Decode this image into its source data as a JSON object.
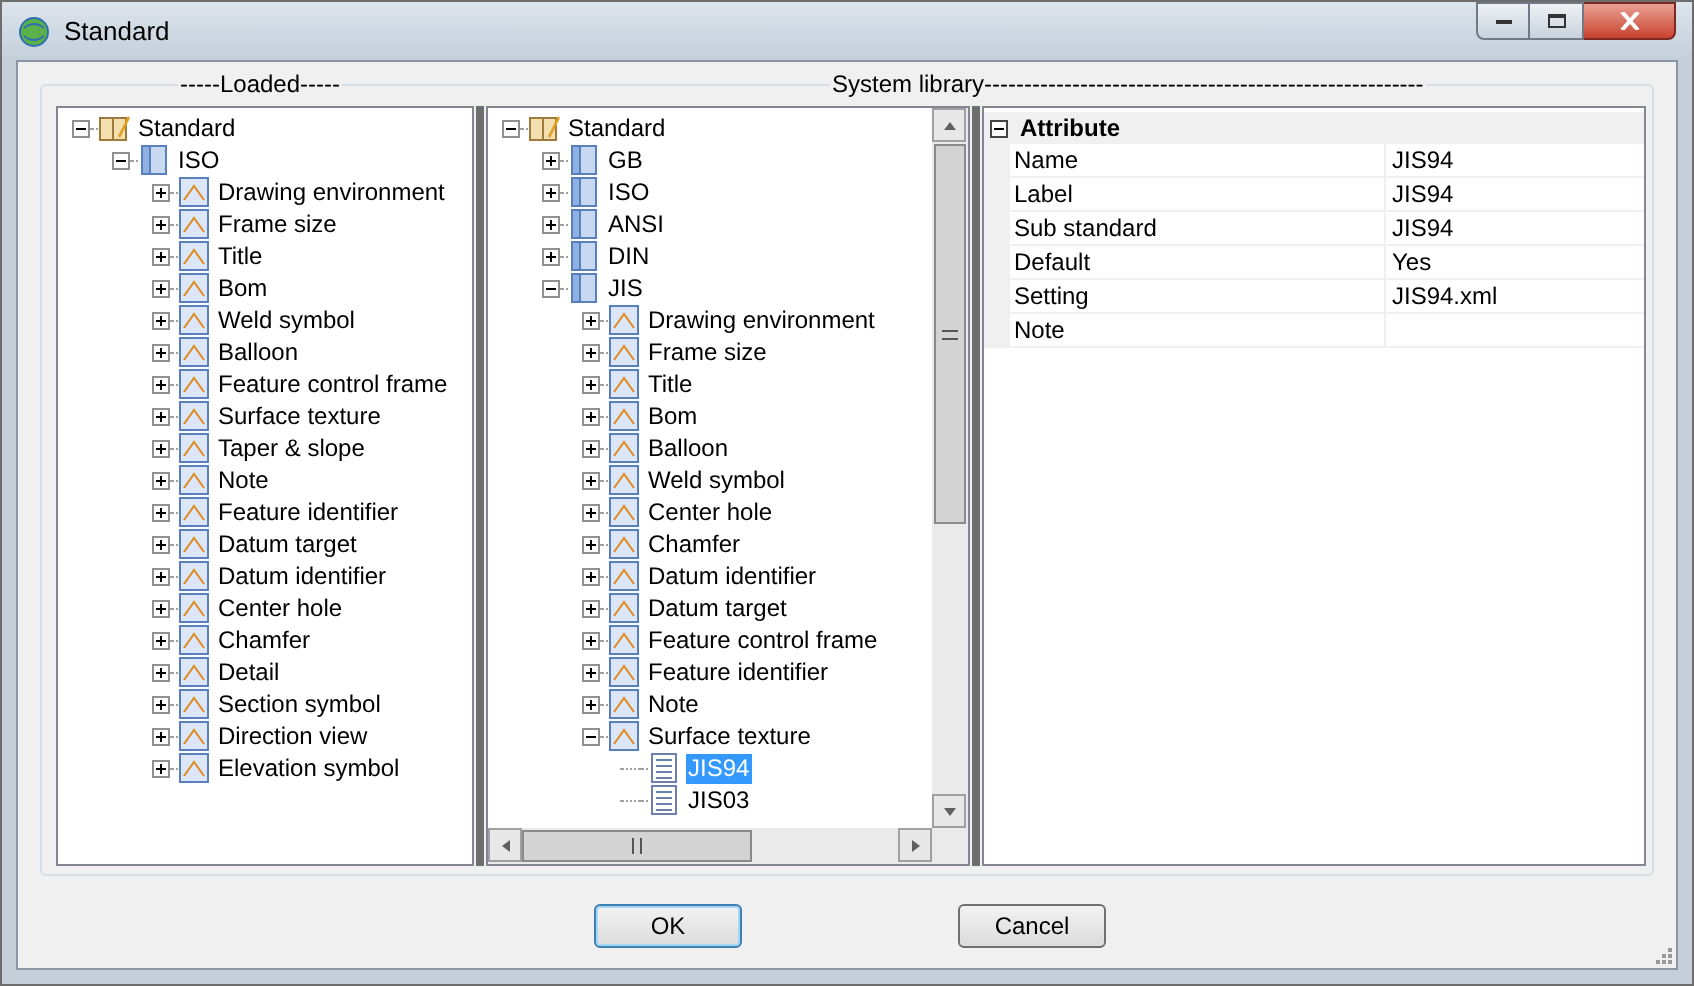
{
  "window": {
    "title": "Standard"
  },
  "loaded": {
    "title": "-----Loaded-----",
    "tree": [
      {
        "label": "Standard",
        "expanded": true,
        "children": [
          {
            "label": "ISO",
            "expanded": true,
            "children": [
              {
                "label": "Drawing environment",
                "expanded": false
              },
              {
                "label": "Frame size",
                "expanded": false
              },
              {
                "label": "Title",
                "expanded": false
              },
              {
                "label": "Bom",
                "expanded": false
              },
              {
                "label": "Weld symbol",
                "expanded": false
              },
              {
                "label": "Balloon",
                "expanded": false
              },
              {
                "label": "Feature control frame",
                "expanded": false
              },
              {
                "label": "Surface texture",
                "expanded": false
              },
              {
                "label": "Taper & slope",
                "expanded": false
              },
              {
                "label": "Note",
                "expanded": false
              },
              {
                "label": "Feature identifier",
                "expanded": false
              },
              {
                "label": "Datum target",
                "expanded": false
              },
              {
                "label": "Datum identifier",
                "expanded": false
              },
              {
                "label": "Center hole",
                "expanded": false
              },
              {
                "label": "Chamfer",
                "expanded": false
              },
              {
                "label": "Detail",
                "expanded": false
              },
              {
                "label": "Section symbol",
                "expanded": false
              },
              {
                "label": "Direction view",
                "expanded": false
              },
              {
                "label": "Elevation symbol",
                "expanded": false
              }
            ]
          }
        ]
      }
    ]
  },
  "system_library": {
    "title": "System library-------------------------------------------------------",
    "tree": [
      {
        "label": "Standard",
        "expanded": true,
        "selected": false,
        "children": [
          {
            "label": "GB",
            "expanded": false,
            "selected": false
          },
          {
            "label": "ISO",
            "expanded": false,
            "selected": false
          },
          {
            "label": "ANSI",
            "expanded": false,
            "selected": false
          },
          {
            "label": "DIN",
            "expanded": false,
            "selected": false
          },
          {
            "label": "JIS",
            "expanded": true,
            "selected": false,
            "children": [
              {
                "label": "Drawing environment",
                "expanded": false,
                "selected": false
              },
              {
                "label": "Frame size",
                "expanded": false,
                "selected": false
              },
              {
                "label": "Title",
                "expanded": false,
                "selected": false
              },
              {
                "label": "Bom",
                "expanded": false,
                "selected": false
              },
              {
                "label": "Balloon",
                "expanded": false,
                "selected": false
              },
              {
                "label": "Weld symbol",
                "expanded": false,
                "selected": false
              },
              {
                "label": "Center hole",
                "expanded": false,
                "selected": false
              },
              {
                "label": "Chamfer",
                "expanded": false,
                "selected": false
              },
              {
                "label": "Datum identifier",
                "expanded": false,
                "selected": false
              },
              {
                "label": "Datum target",
                "expanded": false,
                "selected": false
              },
              {
                "label": "Feature control frame",
                "expanded": false,
                "selected": false
              },
              {
                "label": "Feature identifier",
                "expanded": false,
                "selected": false
              },
              {
                "label": "Note",
                "expanded": false,
                "selected": false
              },
              {
                "label": "Surface texture",
                "expanded": true,
                "selected": false,
                "children": [
                  {
                    "label": "JIS94",
                    "selected": true
                  },
                  {
                    "label": "JIS03",
                    "selected": false
                  }
                ]
              }
            ]
          }
        ]
      }
    ]
  },
  "properties": {
    "category": "Attribute",
    "expanded": true,
    "rows": [
      {
        "name": "Name",
        "value": "JIS94"
      },
      {
        "name": "Label",
        "value": "JIS94"
      },
      {
        "name": "Sub standard",
        "value": "JIS94"
      },
      {
        "name": "Default",
        "value": "Yes"
      },
      {
        "name": "Setting",
        "value": "JIS94.xml"
      },
      {
        "name": "Note",
        "value": ""
      }
    ]
  },
  "buttons": [
    {
      "label": "OK",
      "default": true
    },
    {
      "label": "Cancel",
      "default": false
    }
  ]
}
